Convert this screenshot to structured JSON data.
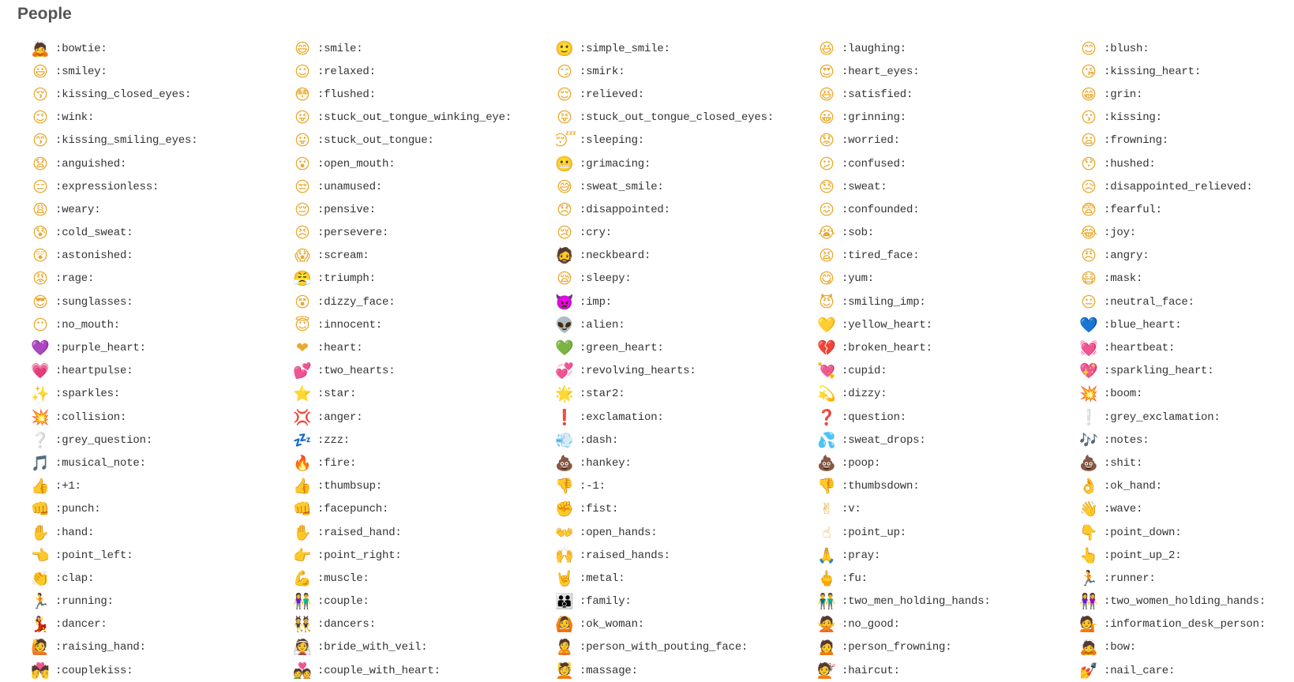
{
  "section": {
    "title": "People"
  },
  "items": [
    {
      "code": ":bowtie:",
      "glyph": "🙇",
      "icon": "bowtie-icon"
    },
    {
      "code": ":smile:",
      "glyph": "😄",
      "icon": "smile-icon"
    },
    {
      "code": ":simple_smile:",
      "glyph": "🙂",
      "icon": "simple-smile-icon"
    },
    {
      "code": ":laughing:",
      "glyph": "😆",
      "icon": "laughing-icon"
    },
    {
      "code": ":blush:",
      "glyph": "😊",
      "icon": "blush-icon"
    },
    {
      "code": ":smiley:",
      "glyph": "😃",
      "icon": "smiley-icon"
    },
    {
      "code": ":relaxed:",
      "glyph": "☺",
      "icon": "relaxed-icon"
    },
    {
      "code": ":smirk:",
      "glyph": "😏",
      "icon": "smirk-icon"
    },
    {
      "code": ":heart_eyes:",
      "glyph": "😍",
      "icon": "heart-eyes-icon"
    },
    {
      "code": ":kissing_heart:",
      "glyph": "😘",
      "icon": "kissing-heart-icon"
    },
    {
      "code": ":kissing_closed_eyes:",
      "glyph": "😚",
      "icon": "kissing-closed-eyes-icon"
    },
    {
      "code": ":flushed:",
      "glyph": "😳",
      "icon": "flushed-icon"
    },
    {
      "code": ":relieved:",
      "glyph": "😌",
      "icon": "relieved-icon"
    },
    {
      "code": ":satisfied:",
      "glyph": "😆",
      "icon": "satisfied-icon"
    },
    {
      "code": ":grin:",
      "glyph": "😁",
      "icon": "grin-icon"
    },
    {
      "code": ":wink:",
      "glyph": "😉",
      "icon": "wink-icon"
    },
    {
      "code": ":stuck_out_tongue_winking_eye:",
      "glyph": "😜",
      "icon": "stuck-out-tongue-winking-eye-icon"
    },
    {
      "code": ":stuck_out_tongue_closed_eyes:",
      "glyph": "😝",
      "icon": "stuck-out-tongue-closed-eyes-icon"
    },
    {
      "code": ":grinning:",
      "glyph": "😀",
      "icon": "grinning-icon"
    },
    {
      "code": ":kissing:",
      "glyph": "😗",
      "icon": "kissing-icon"
    },
    {
      "code": ":kissing_smiling_eyes:",
      "glyph": "😙",
      "icon": "kissing-smiling-eyes-icon"
    },
    {
      "code": ":stuck_out_tongue:",
      "glyph": "😛",
      "icon": "stuck-out-tongue-icon"
    },
    {
      "code": ":sleeping:",
      "glyph": "😴",
      "icon": "sleeping-icon"
    },
    {
      "code": ":worried:",
      "glyph": "😟",
      "icon": "worried-icon"
    },
    {
      "code": ":frowning:",
      "glyph": "😦",
      "icon": "frowning-icon"
    },
    {
      "code": ":anguished:",
      "glyph": "😧",
      "icon": "anguished-icon"
    },
    {
      "code": ":open_mouth:",
      "glyph": "😮",
      "icon": "open-mouth-icon"
    },
    {
      "code": ":grimacing:",
      "glyph": "😬",
      "icon": "grimacing-icon"
    },
    {
      "code": ":confused:",
      "glyph": "😕",
      "icon": "confused-icon"
    },
    {
      "code": ":hushed:",
      "glyph": "😯",
      "icon": "hushed-icon"
    },
    {
      "code": ":expressionless:",
      "glyph": "😑",
      "icon": "expressionless-icon"
    },
    {
      "code": ":unamused:",
      "glyph": "😒",
      "icon": "unamused-icon"
    },
    {
      "code": ":sweat_smile:",
      "glyph": "😅",
      "icon": "sweat-smile-icon"
    },
    {
      "code": ":sweat:",
      "glyph": "😓",
      "icon": "sweat-icon"
    },
    {
      "code": ":disappointed_relieved:",
      "glyph": "😥",
      "icon": "disappointed-relieved-icon"
    },
    {
      "code": ":weary:",
      "glyph": "😩",
      "icon": "weary-icon"
    },
    {
      "code": ":pensive:",
      "glyph": "😔",
      "icon": "pensive-icon"
    },
    {
      "code": ":disappointed:",
      "glyph": "😞",
      "icon": "disappointed-icon"
    },
    {
      "code": ":confounded:",
      "glyph": "😖",
      "icon": "confounded-icon"
    },
    {
      "code": ":fearful:",
      "glyph": "😨",
      "icon": "fearful-icon"
    },
    {
      "code": ":cold_sweat:",
      "glyph": "😰",
      "icon": "cold-sweat-icon"
    },
    {
      "code": ":persevere:",
      "glyph": "😣",
      "icon": "persevere-icon"
    },
    {
      "code": ":cry:",
      "glyph": "😢",
      "icon": "cry-icon"
    },
    {
      "code": ":sob:",
      "glyph": "😭",
      "icon": "sob-icon"
    },
    {
      "code": ":joy:",
      "glyph": "😂",
      "icon": "joy-icon"
    },
    {
      "code": ":astonished:",
      "glyph": "😲",
      "icon": "astonished-icon"
    },
    {
      "code": ":scream:",
      "glyph": "😱",
      "icon": "scream-icon"
    },
    {
      "code": ":neckbeard:",
      "glyph": "🧔",
      "icon": "neckbeard-icon"
    },
    {
      "code": ":tired_face:",
      "glyph": "😫",
      "icon": "tired-face-icon"
    },
    {
      "code": ":angry:",
      "glyph": "😠",
      "icon": "angry-icon"
    },
    {
      "code": ":rage:",
      "glyph": "😡",
      "icon": "rage-icon"
    },
    {
      "code": ":triumph:",
      "glyph": "😤",
      "icon": "triumph-icon"
    },
    {
      "code": ":sleepy:",
      "glyph": "😪",
      "icon": "sleepy-icon"
    },
    {
      "code": ":yum:",
      "glyph": "😋",
      "icon": "yum-icon"
    },
    {
      "code": ":mask:",
      "glyph": "😷",
      "icon": "mask-icon"
    },
    {
      "code": ":sunglasses:",
      "glyph": "😎",
      "icon": "sunglasses-icon"
    },
    {
      "code": ":dizzy_face:",
      "glyph": "😵",
      "icon": "dizzy-face-icon"
    },
    {
      "code": ":imp:",
      "glyph": "👿",
      "icon": "imp-icon"
    },
    {
      "code": ":smiling_imp:",
      "glyph": "😈",
      "icon": "smiling-imp-icon"
    },
    {
      "code": ":neutral_face:",
      "glyph": "😐",
      "icon": "neutral-face-icon"
    },
    {
      "code": ":no_mouth:",
      "glyph": "😶",
      "icon": "no-mouth-icon"
    },
    {
      "code": ":innocent:",
      "glyph": "😇",
      "icon": "innocent-icon"
    },
    {
      "code": ":alien:",
      "glyph": "👽",
      "icon": "alien-icon"
    },
    {
      "code": ":yellow_heart:",
      "glyph": "💛",
      "icon": "yellow-heart-icon"
    },
    {
      "code": ":blue_heart:",
      "glyph": "💙",
      "icon": "blue-heart-icon"
    },
    {
      "code": ":purple_heart:",
      "glyph": "💜",
      "icon": "purple-heart-icon"
    },
    {
      "code": ":heart:",
      "glyph": "❤",
      "icon": "heart-icon"
    },
    {
      "code": ":green_heart:",
      "glyph": "💚",
      "icon": "green-heart-icon"
    },
    {
      "code": ":broken_heart:",
      "glyph": "💔",
      "icon": "broken-heart-icon"
    },
    {
      "code": ":heartbeat:",
      "glyph": "💓",
      "icon": "heartbeat-icon"
    },
    {
      "code": ":heartpulse:",
      "glyph": "💗",
      "icon": "heartpulse-icon"
    },
    {
      "code": ":two_hearts:",
      "glyph": "💕",
      "icon": "two-hearts-icon"
    },
    {
      "code": ":revolving_hearts:",
      "glyph": "💞",
      "icon": "revolving-hearts-icon"
    },
    {
      "code": ":cupid:",
      "glyph": "💘",
      "icon": "cupid-icon"
    },
    {
      "code": ":sparkling_heart:",
      "glyph": "💖",
      "icon": "sparkling-heart-icon"
    },
    {
      "code": ":sparkles:",
      "glyph": "✨",
      "icon": "sparkles-icon"
    },
    {
      "code": ":star:",
      "glyph": "⭐",
      "icon": "star-icon"
    },
    {
      "code": ":star2:",
      "glyph": "🌟",
      "icon": "star2-icon"
    },
    {
      "code": ":dizzy:",
      "glyph": "💫",
      "icon": "dizzy-icon"
    },
    {
      "code": ":boom:",
      "glyph": "💥",
      "icon": "boom-icon"
    },
    {
      "code": ":collision:",
      "glyph": "💥",
      "icon": "collision-icon"
    },
    {
      "code": ":anger:",
      "glyph": "💢",
      "icon": "anger-icon"
    },
    {
      "code": ":exclamation:",
      "glyph": "❗",
      "icon": "exclamation-icon"
    },
    {
      "code": ":question:",
      "glyph": "❓",
      "icon": "question-icon"
    },
    {
      "code": ":grey_exclamation:",
      "glyph": "❕",
      "icon": "grey-exclamation-icon"
    },
    {
      "code": ":grey_question:",
      "glyph": "❔",
      "icon": "grey-question-icon"
    },
    {
      "code": ":zzz:",
      "glyph": "💤",
      "icon": "zzz-icon"
    },
    {
      "code": ":dash:",
      "glyph": "💨",
      "icon": "dash-icon"
    },
    {
      "code": ":sweat_drops:",
      "glyph": "💦",
      "icon": "sweat-drops-icon"
    },
    {
      "code": ":notes:",
      "glyph": "🎶",
      "icon": "notes-icon"
    },
    {
      "code": ":musical_note:",
      "glyph": "🎵",
      "icon": "musical-note-icon"
    },
    {
      "code": ":fire:",
      "glyph": "🔥",
      "icon": "fire-icon"
    },
    {
      "code": ":hankey:",
      "glyph": "💩",
      "icon": "hankey-icon"
    },
    {
      "code": ":poop:",
      "glyph": "💩",
      "icon": "poop-icon"
    },
    {
      "code": ":shit:",
      "glyph": "💩",
      "icon": "shit-icon"
    },
    {
      "code": ":+1:",
      "glyph": "👍",
      "icon": "thumbs-up-icon"
    },
    {
      "code": ":thumbsup:",
      "glyph": "👍",
      "icon": "thumbsup-icon"
    },
    {
      "code": ":-1:",
      "glyph": "👎",
      "icon": "thumbs-down-icon"
    },
    {
      "code": ":thumbsdown:",
      "glyph": "👎",
      "icon": "thumbsdown-icon"
    },
    {
      "code": ":ok_hand:",
      "glyph": "👌",
      "icon": "ok-hand-icon"
    },
    {
      "code": ":punch:",
      "glyph": "👊",
      "icon": "punch-icon"
    },
    {
      "code": ":facepunch:",
      "glyph": "👊",
      "icon": "facepunch-icon"
    },
    {
      "code": ":fist:",
      "glyph": "✊",
      "icon": "fist-icon"
    },
    {
      "code": ":v:",
      "glyph": "✌",
      "icon": "victory-hand-icon"
    },
    {
      "code": ":wave:",
      "glyph": "👋",
      "icon": "wave-icon"
    },
    {
      "code": ":hand:",
      "glyph": "✋",
      "icon": "hand-icon"
    },
    {
      "code": ":raised_hand:",
      "glyph": "✋",
      "icon": "raised-hand-icon"
    },
    {
      "code": ":open_hands:",
      "glyph": "👐",
      "icon": "open-hands-icon"
    },
    {
      "code": ":point_up:",
      "glyph": "☝",
      "icon": "point-up-icon"
    },
    {
      "code": ":point_down:",
      "glyph": "👇",
      "icon": "point-down-icon"
    },
    {
      "code": ":point_left:",
      "glyph": "👈",
      "icon": "point-left-icon"
    },
    {
      "code": ":point_right:",
      "glyph": "👉",
      "icon": "point-right-icon"
    },
    {
      "code": ":raised_hands:",
      "glyph": "🙌",
      "icon": "raised-hands-icon"
    },
    {
      "code": ":pray:",
      "glyph": "🙏",
      "icon": "pray-icon"
    },
    {
      "code": ":point_up_2:",
      "glyph": "👆",
      "icon": "point-up-2-icon"
    },
    {
      "code": ":clap:",
      "glyph": "👏",
      "icon": "clap-icon"
    },
    {
      "code": ":muscle:",
      "glyph": "💪",
      "icon": "muscle-icon"
    },
    {
      "code": ":metal:",
      "glyph": "🤘",
      "icon": "metal-icon"
    },
    {
      "code": ":fu:",
      "glyph": "🖕",
      "icon": "fu-icon"
    },
    {
      "code": ":runner:",
      "glyph": "🏃",
      "icon": "runner-icon"
    },
    {
      "code": ":running:",
      "glyph": "🏃",
      "icon": "running-icon"
    },
    {
      "code": ":couple:",
      "glyph": "👫",
      "icon": "couple-icon"
    },
    {
      "code": ":family:",
      "glyph": "👪",
      "icon": "family-icon"
    },
    {
      "code": ":two_men_holding_hands:",
      "glyph": "👬",
      "icon": "two-men-holding-hands-icon"
    },
    {
      "code": ":two_women_holding_hands:",
      "glyph": "👭",
      "icon": "two-women-holding-hands-icon"
    },
    {
      "code": ":dancer:",
      "glyph": "💃",
      "icon": "dancer-icon"
    },
    {
      "code": ":dancers:",
      "glyph": "👯",
      "icon": "dancers-icon"
    },
    {
      "code": ":ok_woman:",
      "glyph": "🙆",
      "icon": "ok-woman-icon"
    },
    {
      "code": ":no_good:",
      "glyph": "🙅",
      "icon": "no-good-icon"
    },
    {
      "code": ":information_desk_person:",
      "glyph": "💁",
      "icon": "information-desk-person-icon"
    },
    {
      "code": ":raising_hand:",
      "glyph": "🙋",
      "icon": "raising-hand-icon"
    },
    {
      "code": ":bride_with_veil:",
      "glyph": "👰",
      "icon": "bride-with-veil-icon"
    },
    {
      "code": ":person_with_pouting_face:",
      "glyph": "🙎",
      "icon": "person-with-pouting-face-icon"
    },
    {
      "code": ":person_frowning:",
      "glyph": "🙍",
      "icon": "person-frowning-icon"
    },
    {
      "code": ":bow:",
      "glyph": "🙇",
      "icon": "bow-icon"
    },
    {
      "code": ":couplekiss:",
      "glyph": "💏",
      "icon": "couplekiss-icon"
    },
    {
      "code": ":couple_with_heart:",
      "glyph": "💑",
      "icon": "couple-with-heart-icon"
    },
    {
      "code": ":massage:",
      "glyph": "💆",
      "icon": "massage-icon"
    },
    {
      "code": ":haircut:",
      "glyph": "💇",
      "icon": "haircut-icon"
    },
    {
      "code": ":nail_care:",
      "glyph": "💅",
      "icon": "nail-care-icon"
    }
  ]
}
